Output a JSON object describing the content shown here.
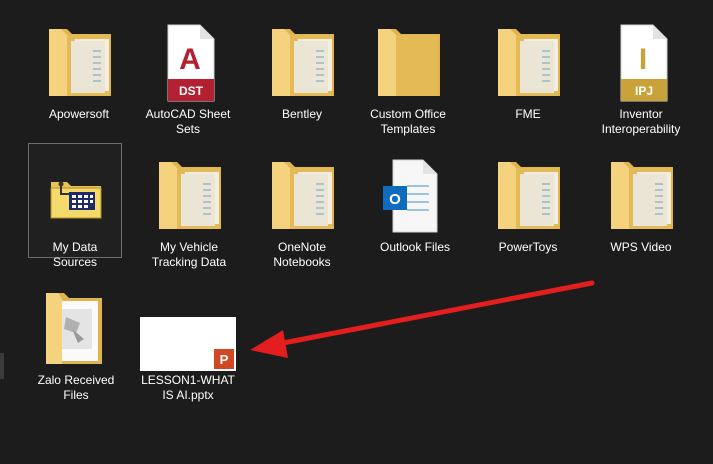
{
  "items": [
    {
      "label": "Apowersoft",
      "icon": "folder-icon"
    },
    {
      "label": "AutoCAD Sheet\nSets",
      "icon": "dst-file-icon",
      "badge": "DST",
      "letter": "A"
    },
    {
      "label": "Bentley",
      "icon": "folder-icon"
    },
    {
      "label": "Custom Office\nTemplates",
      "icon": "folder-icon"
    },
    {
      "label": "FME",
      "icon": "folder-icon"
    },
    {
      "label": "Inventor\nInteroperability",
      "icon": "ipj-file-icon",
      "badge": "IPJ",
      "letter": "I"
    },
    {
      "label": "My Data Sources",
      "icon": "data-sources-folder-icon"
    },
    {
      "label": "My Vehicle\nTracking Data",
      "icon": "folder-icon"
    },
    {
      "label": "OneNote\nNotebooks",
      "icon": "folder-icon"
    },
    {
      "label": "Outlook Files",
      "icon": "outlook-folder-icon",
      "letter": "O"
    },
    {
      "label": "PowerToys",
      "icon": "folder-icon"
    },
    {
      "label": "WPS Video",
      "icon": "folder-icon"
    },
    {
      "label": "Zalo Received\nFiles",
      "icon": "zalo-folder-icon"
    },
    {
      "label": "LESSON1-WHAT\nIS AI.pptx",
      "icon": "pptx-thumbnail-icon",
      "letter": "P"
    }
  ],
  "colors": {
    "background": "#1c1c1c",
    "folder_back": "#e0b54e",
    "folder_front": "#f5d27d",
    "arrow": "#e31e1e",
    "autocad_red": "#b32032",
    "inventor_gold": "#c9a23a",
    "outlook_blue": "#0f6cbd",
    "powerpoint_orange": "#d24726"
  }
}
